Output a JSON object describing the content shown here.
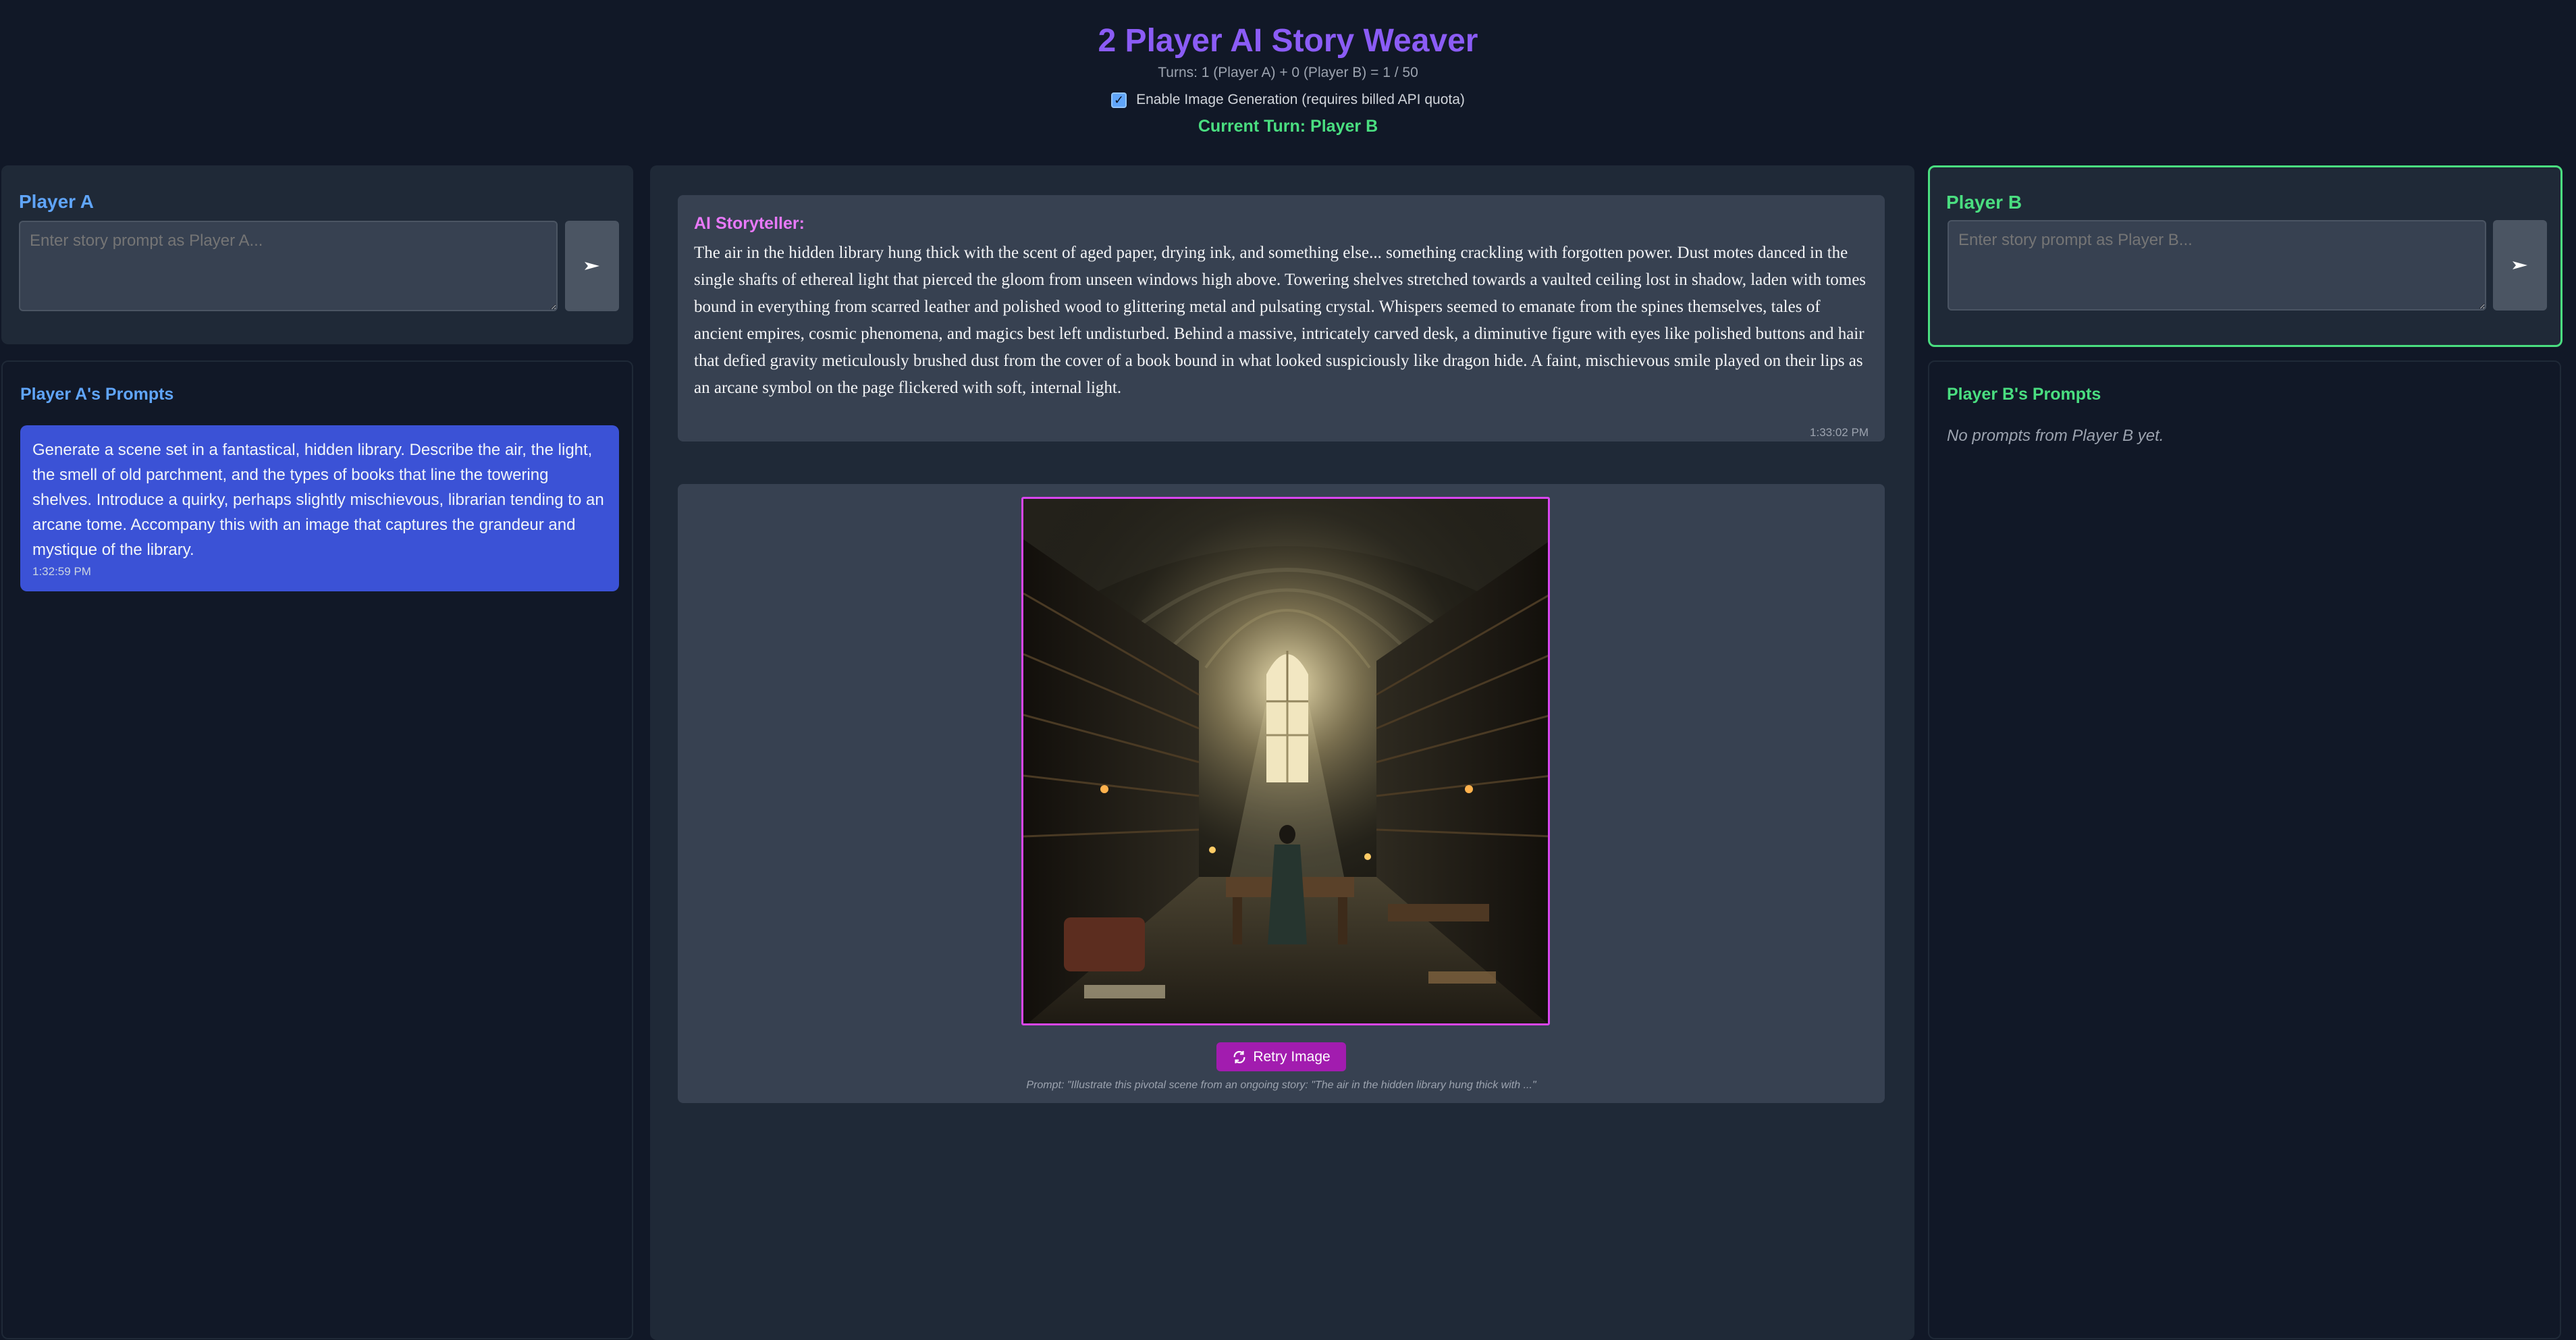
{
  "header": {
    "title": "2 Player AI Story Weaver",
    "turns": "Turns: 1 (Player A) + 0 (Player B) = 1 / 50",
    "image_generation_label": "Enable Image Generation (requires billed API quota)",
    "image_generation_enabled": true,
    "current_turn": "Current Turn: Player B"
  },
  "player_a": {
    "title": "Player A",
    "color": "#60a5fa",
    "input_placeholder": "Enter story prompt as Player A...",
    "send_icon": "send-icon",
    "prompts_title": "Player A's Prompts",
    "prompts": [
      {
        "text": "Generate a scene set in a fantastical, hidden library. Describe the air, the light, the smell of old parchment, and the types of books that line the towering shelves. Introduce a quirky, perhaps slightly mischievous, librarian tending to an arcane tome. Accompany this with an image that captures the grandeur and mystique of the library.",
        "time": "1:32:59 PM"
      }
    ]
  },
  "player_b": {
    "title": "Player B",
    "color": "#4ade80",
    "input_placeholder": "Enter story prompt as Player B...",
    "send_icon": "send-icon",
    "prompts_title": "Player B's Prompts",
    "no_prompts": "No prompts from Player B yet."
  },
  "story": {
    "label": "AI Storyteller:",
    "text": "The air in the hidden library hung thick with the scent of aged paper, drying ink, and something else... something crackling with forgotten power. Dust motes danced in the single shafts of ethereal light that pierced the gloom from unseen windows high above. Towering shelves stretched towards a vaulted ceiling lost in shadow, laden with tomes bound in everything from scarred leather and polished wood to glittering metal and pulsating crystal. Whispers seemed to emanate from the spines themselves, tales of ancient empires, cosmic phenomena, and magics best left undisturbed. Behind a massive, intricately carved desk, a diminutive figure with eyes like polished buttons and hair that defied gravity meticulously brushed dust from the cover of a book bound in what looked suspiciously like dragon hide. A faint, mischievous smile played on their lips as an arcane symbol on the page flickered with soft, internal light.",
    "time": "1:33:02 PM"
  },
  "image": {
    "retry_label": "Retry Image",
    "retry_icon": "refresh-icon",
    "prompt_caption": "Prompt: \"Illustrate this pivotal scene from an ongoing story: \"The air in the hidden library hung thick with ...\""
  }
}
